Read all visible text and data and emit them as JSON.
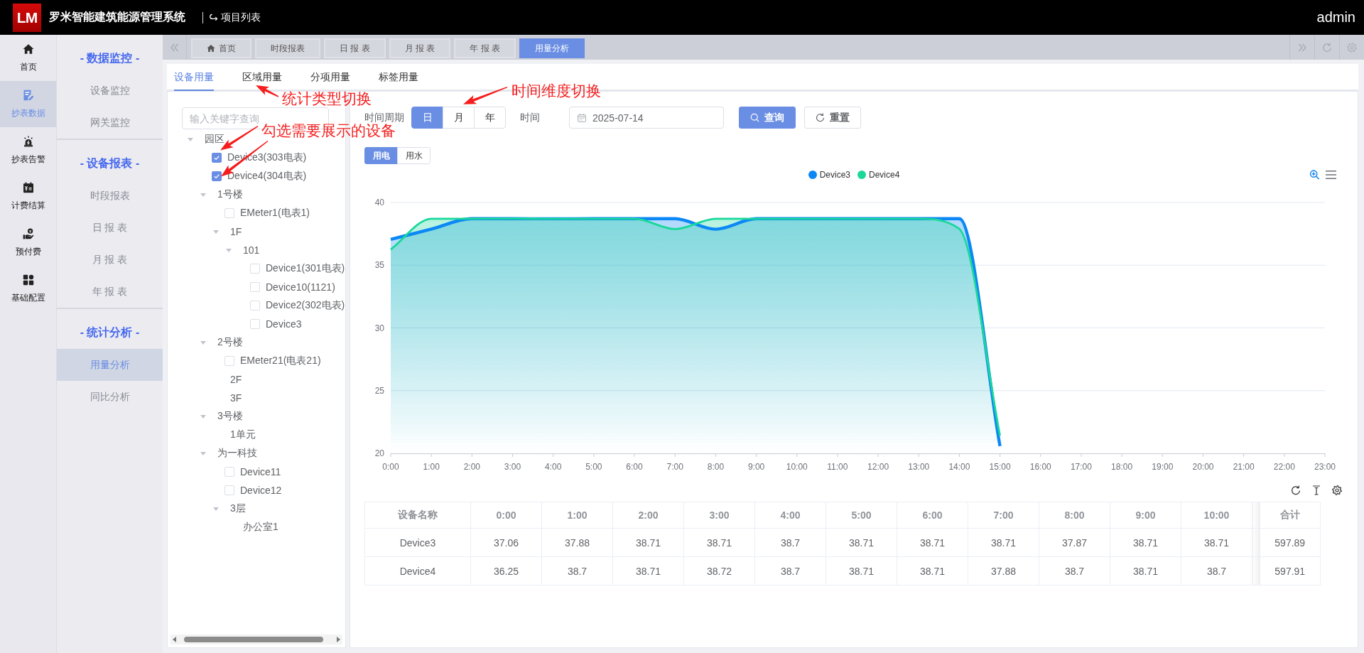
{
  "header": {
    "logo": "LM",
    "title": "罗米智能建筑能源管理系统",
    "project_link": "项目列表",
    "user": "admin"
  },
  "icon_nav": [
    {
      "label": "首页",
      "selected": false
    },
    {
      "label": "抄表数据",
      "selected": true
    },
    {
      "label": "抄表告警",
      "selected": false
    },
    {
      "label": "计费结算",
      "selected": false
    },
    {
      "label": "预付费",
      "selected": false
    },
    {
      "label": "基础配置",
      "selected": false
    }
  ],
  "menu": [
    {
      "title": "- 数据监控 -",
      "items": [
        {
          "label": "设备监控",
          "selected": false
        },
        {
          "label": "网关监控",
          "selected": false
        }
      ]
    },
    {
      "title": "- 设备报表 -",
      "items": [
        {
          "label": "时段报表",
          "selected": false
        },
        {
          "label": "日 报 表",
          "selected": false
        },
        {
          "label": "月 报 表",
          "selected": false
        },
        {
          "label": "年 报 表",
          "selected": false
        }
      ]
    },
    {
      "title": "- 统计分析 -",
      "items": [
        {
          "label": "用量分析",
          "selected": true
        },
        {
          "label": "同比分析",
          "selected": false
        }
      ]
    }
  ],
  "page_tabs": [
    {
      "label": "首页",
      "kind": "home",
      "selected": false
    },
    {
      "label": "时段报表",
      "kind": "page",
      "selected": false
    },
    {
      "label": "日 报 表",
      "kind": "page",
      "selected": false
    },
    {
      "label": "月 报 表",
      "kind": "page",
      "selected": false
    },
    {
      "label": "年 报 表",
      "kind": "page",
      "selected": false
    },
    {
      "label": "用量分析",
      "kind": "page",
      "selected": true
    }
  ],
  "sub_tabs": [
    {
      "label": "设备用量",
      "selected": true
    },
    {
      "label": "区域用量",
      "selected": false
    },
    {
      "label": "分项用量",
      "selected": false
    },
    {
      "label": "标签用量",
      "selected": false
    }
  ],
  "tree": {
    "placeholder": "输入关键字查询",
    "nodes": [
      {
        "label": "园区",
        "kind": "group",
        "expanded": true,
        "children": [
          {
            "label": "Device3(303电表)",
            "kind": "device",
            "checked": true
          },
          {
            "label": "Device4(304电表)",
            "kind": "device",
            "checked": true
          },
          {
            "label": "1号楼",
            "kind": "group",
            "expanded": true,
            "children": [
              {
                "label": "EMeter1(电表1)",
                "kind": "device",
                "checked": false
              },
              {
                "label": "1F",
                "kind": "group",
                "expanded": true,
                "children": [
                  {
                    "label": "101",
                    "kind": "group",
                    "expanded": true,
                    "children": [
                      {
                        "label": "Device1(301电表)",
                        "kind": "device",
                        "checked": false
                      },
                      {
                        "label": "Device10(1121)",
                        "kind": "device",
                        "checked": false
                      },
                      {
                        "label": "Device2(302电表)",
                        "kind": "device",
                        "checked": false
                      },
                      {
                        "label": "Device3",
                        "kind": "device",
                        "checked": false
                      }
                    ]
                  }
                ]
              }
            ]
          },
          {
            "label": "2号楼",
            "kind": "group",
            "expanded": true,
            "children": [
              {
                "label": "EMeter21(电表21)",
                "kind": "device",
                "checked": false
              },
              {
                "label": "2F",
                "kind": "group"
              },
              {
                "label": "3F",
                "kind": "group"
              }
            ]
          },
          {
            "label": "3号楼",
            "kind": "group",
            "expanded": true,
            "children": [
              {
                "label": "1单元",
                "kind": "group"
              }
            ]
          },
          {
            "label": "为一科技",
            "kind": "group",
            "expanded": true,
            "children": [
              {
                "label": "Device11",
                "kind": "device",
                "checked": false
              },
              {
                "label": "Device12",
                "kind": "device",
                "checked": false
              },
              {
                "label": "3层",
                "kind": "group",
                "expanded": true,
                "children": [
                  {
                    "label": "办公室1",
                    "kind": "group"
                  }
                ]
              }
            ]
          }
        ]
      }
    ]
  },
  "filters": {
    "period_label": "时间周期",
    "periods": [
      {
        "label": "日",
        "selected": true
      },
      {
        "label": "月",
        "selected": false
      },
      {
        "label": "年",
        "selected": false
      }
    ],
    "date_label": "时间",
    "date": "2025-07-14",
    "query_button": "查询",
    "reset_button": "重置"
  },
  "energy_types": [
    {
      "label": "用电",
      "selected": true
    },
    {
      "label": "用水",
      "selected": false
    }
  ],
  "chart": {
    "chart_data": {
      "type": "area",
      "categories": [
        "0:00",
        "1:00",
        "2:00",
        "3:00",
        "4:00",
        "5:00",
        "6:00",
        "7:00",
        "8:00",
        "9:00",
        "10:00",
        "11:00",
        "12:00",
        "13:00",
        "14:00",
        "15:00",
        "16:00",
        "17:00",
        "18:00",
        "19:00",
        "20:00",
        "21:00",
        "22:00",
        "23:00"
      ],
      "series": [
        {
          "name": "Device3",
          "color": "#0b88f5",
          "values": [
            37.06,
            37.88,
            38.71,
            38.71,
            38.7,
            38.71,
            38.71,
            38.71,
            37.87,
            38.71,
            38.71,
            38.71,
            38.71,
            38.71,
            38.71,
            20.57,
            null,
            null,
            null,
            null,
            null,
            null,
            null,
            null
          ]
        },
        {
          "name": "Device4",
          "color": "#19d89a",
          "values": [
            36.25,
            38.7,
            38.71,
            38.72,
            38.7,
            38.71,
            38.71,
            37.88,
            38.7,
            38.71,
            38.7,
            38.71,
            38.71,
            38.7,
            37.9,
            21.42,
            null,
            null,
            null,
            null,
            null,
            null,
            null,
            null
          ]
        }
      ],
      "ylim": [
        20,
        40
      ],
      "yticks": [
        20,
        25,
        30,
        35,
        40
      ],
      "grid": true
    }
  },
  "table": {
    "columns": [
      "设备名称",
      "0:00",
      "1:00",
      "2:00",
      "3:00",
      "4:00",
      "5:00",
      "6:00",
      "7:00",
      "8:00",
      "9:00",
      "10:00"
    ],
    "total_column": "合计",
    "rows": [
      {
        "cells": [
          "Device3",
          "37.06",
          "37.88",
          "38.71",
          "38.71",
          "38.7",
          "38.71",
          "38.71",
          "38.71",
          "37.87",
          "38.71",
          "38.71"
        ],
        "total": "597.89"
      },
      {
        "cells": [
          "Device4",
          "36.25",
          "38.7",
          "38.71",
          "38.72",
          "38.7",
          "38.71",
          "38.71",
          "37.88",
          "38.7",
          "38.71",
          "38.7"
        ],
        "total": "597.91"
      }
    ]
  },
  "annotations": [
    {
      "text": "时间维度切换"
    },
    {
      "text": "统计类型切换"
    },
    {
      "text": "勾选需要展示的设备"
    }
  ]
}
